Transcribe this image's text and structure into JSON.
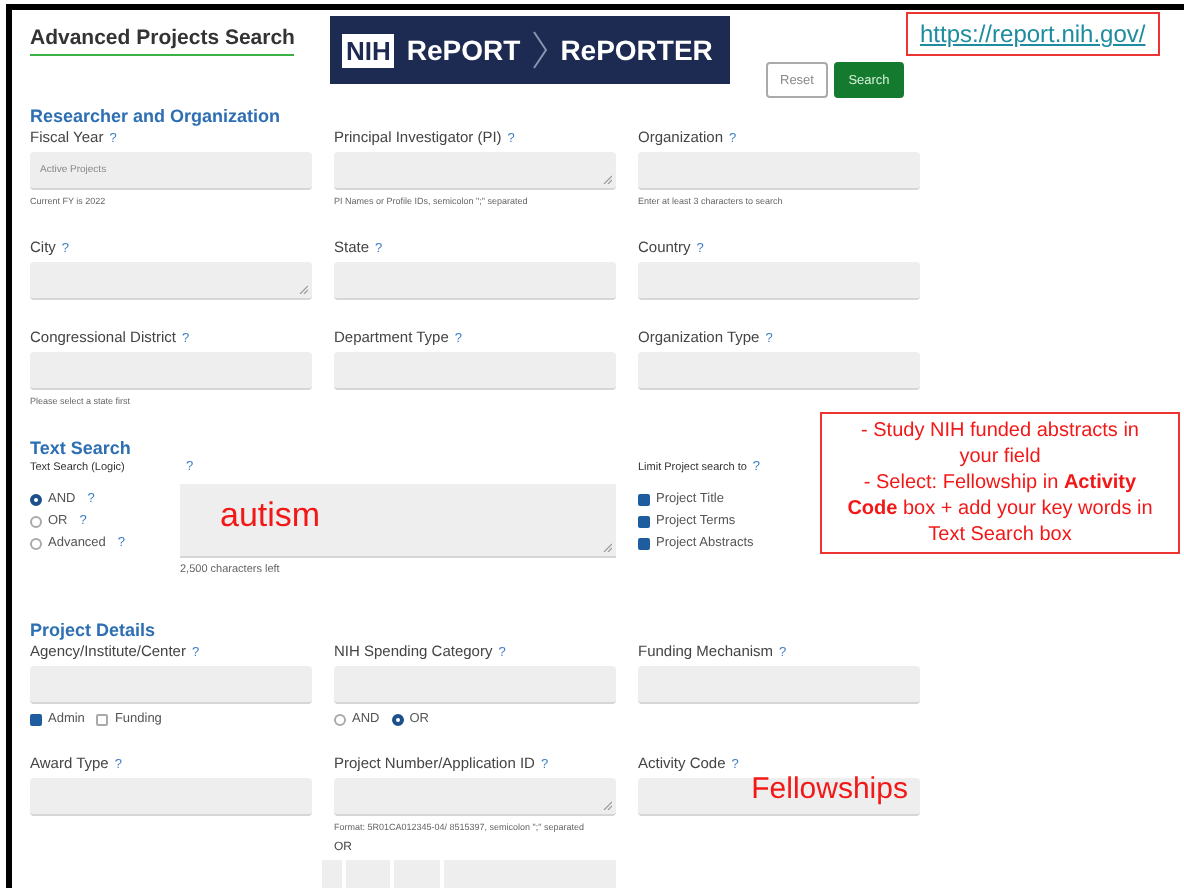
{
  "header": {
    "title": "Advanced Projects Search",
    "logo": [
      "NIH",
      "RePORT",
      "RePORTER"
    ],
    "buttons": [
      {
        "label": "Reset",
        "kind": "secondary"
      },
      {
        "label": "Search",
        "kind": "primary"
      }
    ],
    "url": "https://report.nih.gov/"
  },
  "researcher": {
    "title": "Researcher and Organization",
    "rows": [
      [
        {
          "label": "Fiscal Year",
          "help": "?",
          "kind": "select",
          "placeholder": "Active Projects",
          "hint": "Current FY is 2022"
        },
        {
          "label": "Principal Investigator (PI)",
          "help": "?",
          "kind": "textarea",
          "hint": "PI Names or Profile IDs, semicolon \";\" separated"
        },
        {
          "label": "Organization",
          "help": "?",
          "kind": "select",
          "hint": "Enter at least 3 characters to search"
        }
      ],
      [
        {
          "label": "City",
          "help": "?",
          "kind": "textarea"
        },
        {
          "label": "State",
          "help": "?",
          "kind": "select"
        },
        {
          "label": "Country",
          "help": "?",
          "kind": "select"
        }
      ],
      [
        {
          "label": "Congressional District",
          "help": "?",
          "kind": "select",
          "hint": "Please select a state first"
        },
        {
          "label": "Department Type",
          "help": "?",
          "kind": "select"
        },
        {
          "label": "Organization Type",
          "help": "?",
          "kind": "select"
        }
      ]
    ]
  },
  "text_search": {
    "title": "Text Search",
    "logic_label": "Text Search (Logic)",
    "logic_help": "?",
    "options": [
      {
        "label": "AND",
        "help": "?",
        "selected": true
      },
      {
        "label": "OR",
        "help": "?",
        "selected": false
      },
      {
        "label": "Advanced",
        "help": "?",
        "selected": false
      }
    ],
    "value": "autism",
    "counter": "2,500 characters left",
    "limit": {
      "label": "Limit Project search to",
      "help": "?",
      "options": [
        {
          "label": "Project Title",
          "checked": true
        },
        {
          "label": "Project Terms",
          "checked": true
        },
        {
          "label": "Project Abstracts",
          "checked": true
        }
      ]
    }
  },
  "note": [
    "- Study NIH funded abstracts in your field",
    "- Select: Fellowship in **Activity Code** box + add your key words in Text Search box"
  ],
  "project_details": {
    "title": "Project Details",
    "rows": [
      [
        {
          "label": "Agency/Institute/Center",
          "help": "?",
          "kind": "select",
          "options": [
            {
              "kind": "checkbox",
              "label": "Admin",
              "checked": true
            },
            {
              "kind": "checkbox",
              "label": "Funding",
              "checked": false
            }
          ]
        },
        {
          "label": "NIH Spending Category",
          "help": "?",
          "kind": "select",
          "options": [
            {
              "kind": "radio",
              "label": "AND",
              "selected": false
            },
            {
              "kind": "radio",
              "label": "OR",
              "selected": true
            }
          ]
        },
        {
          "label": "Funding Mechanism",
          "help": "?",
          "kind": "select"
        }
      ],
      [
        {
          "label": "Award Type",
          "help": "?",
          "kind": "select"
        },
        {
          "label": "Project Number/Application ID",
          "help": "?",
          "kind": "textarea",
          "hint": "Format: 5R01CA012345-04/ 8515397, semicolon \";\" separated",
          "or_label": "OR"
        },
        {
          "label": "Activity Code",
          "help": "?",
          "kind": "select",
          "value": "Fellowships"
        }
      ]
    ]
  }
}
